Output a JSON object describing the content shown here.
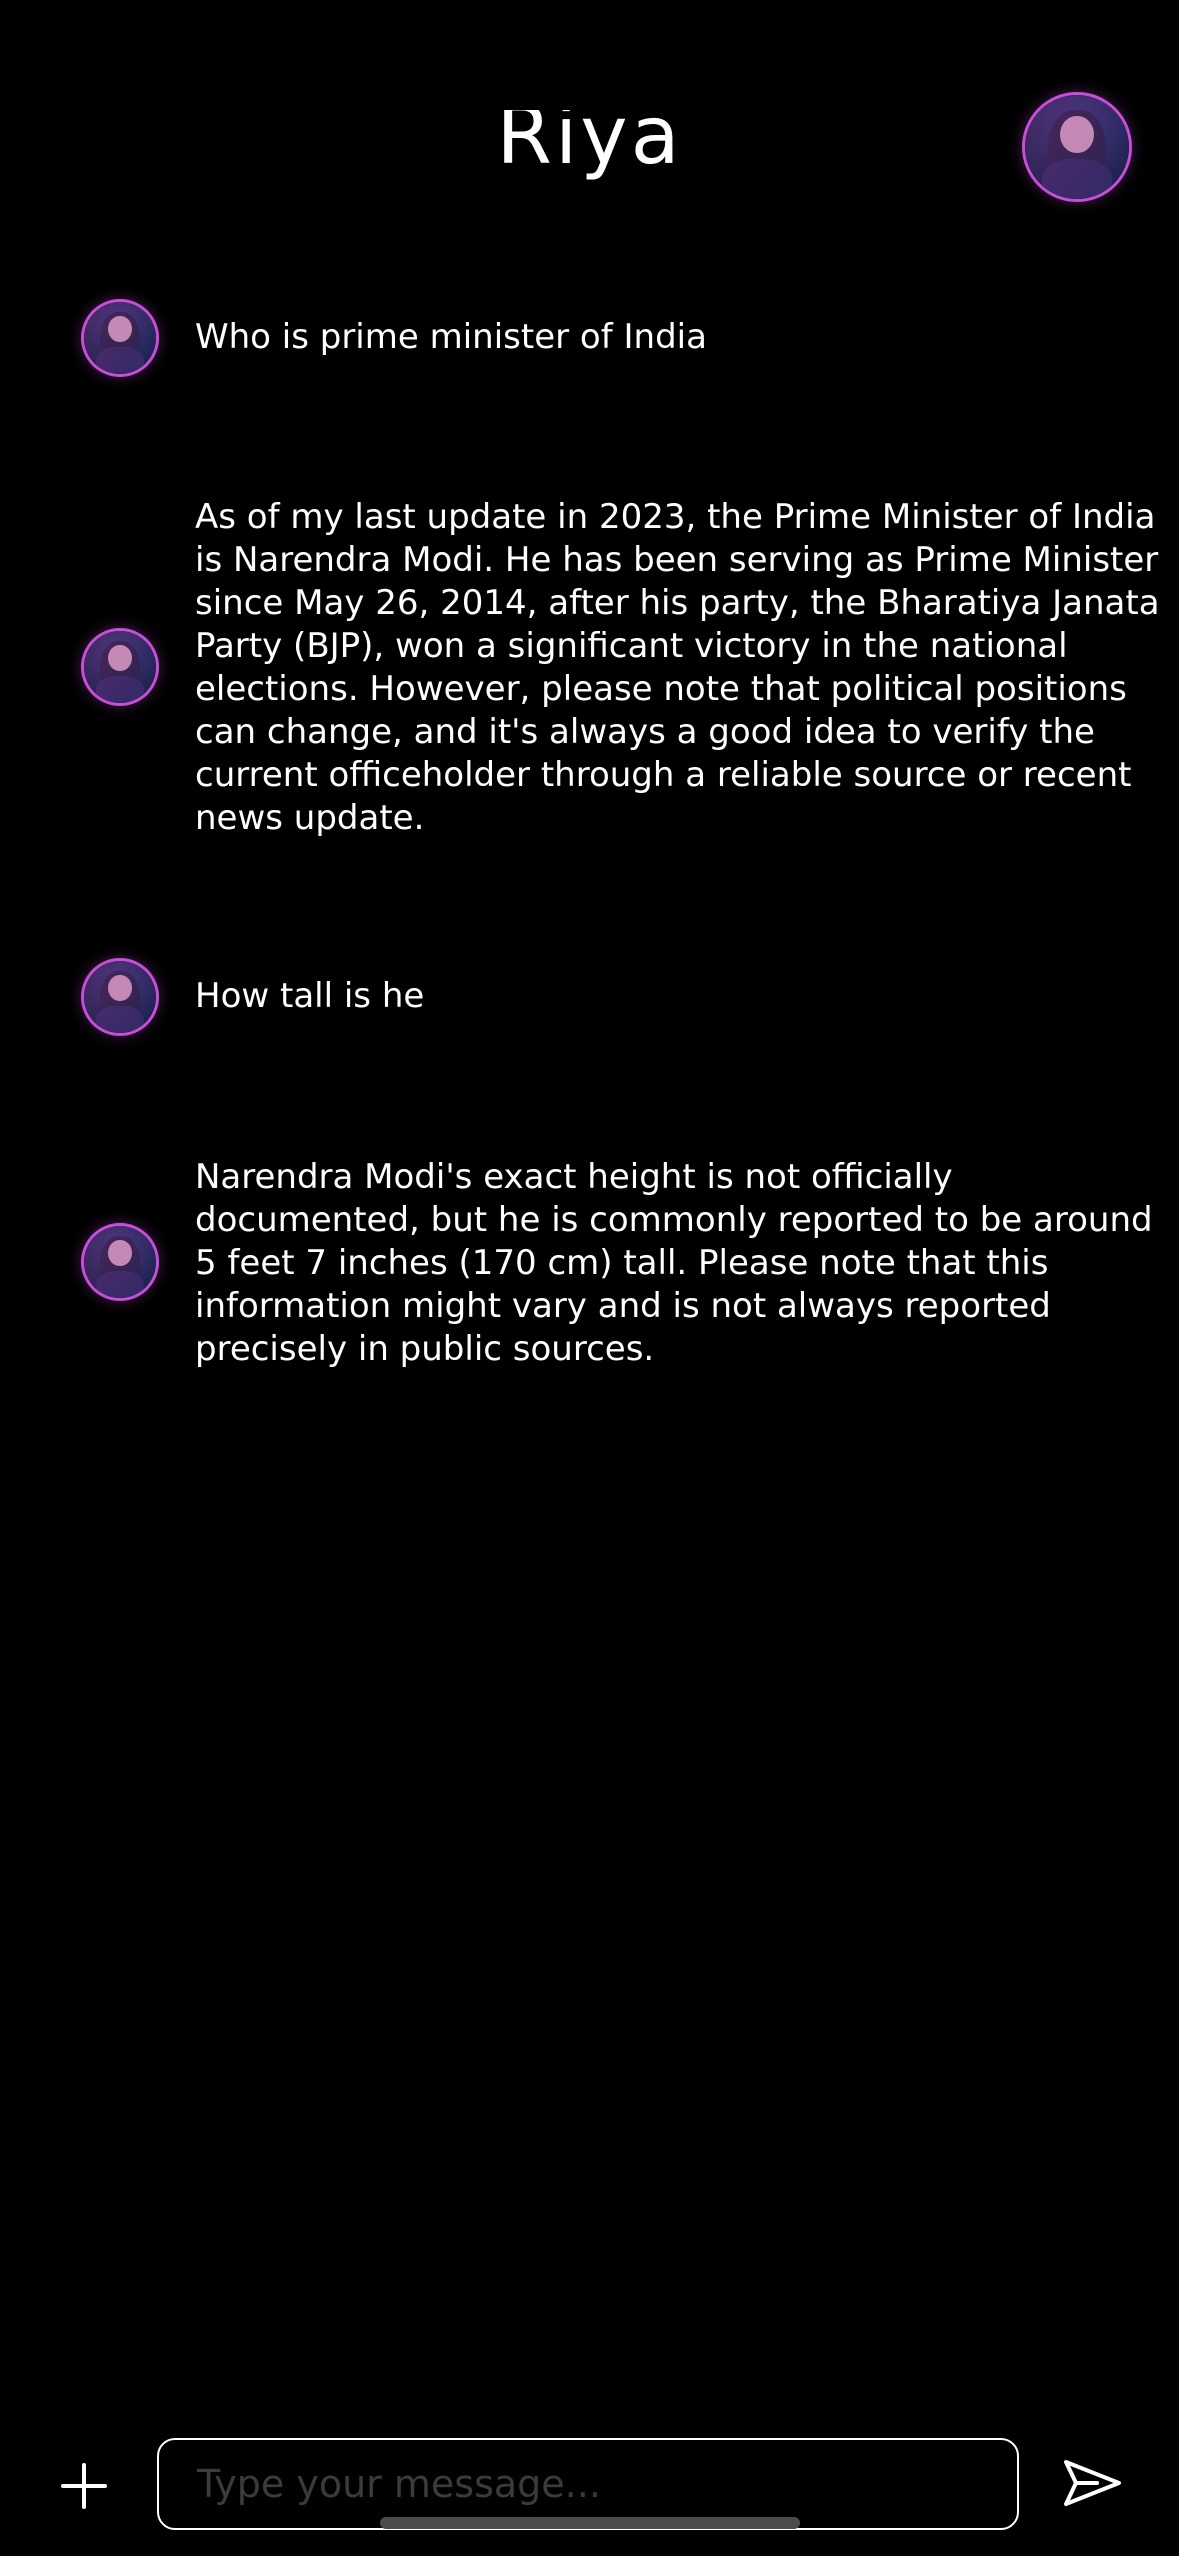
{
  "header": {
    "title": "Riya"
  },
  "messages": [
    {
      "role": "user",
      "text": "Who is prime minister of India"
    },
    {
      "role": "assistant",
      "text": "As of my last update in 2023, the Prime Minister of India is Narendra Modi. He has been serving as Prime Minister since May 26, 2014, after his party, the Bharatiya Janata Party (BJP), won a significant victory in the national elections. However, please note that political positions can change, and it's always a good idea to verify the current officeholder through a reliable source or recent news update."
    },
    {
      "role": "user",
      "text": "How tall is he"
    },
    {
      "role": "assistant",
      "text": "Narendra Modi's exact height is not officially documented, but he is commonly reported to be around 5 feet 7 inches (170 cm) tall. Please note that this information might vary and is not always reported precisely in public sources."
    }
  ],
  "composer": {
    "placeholder": "Type your message...",
    "value": ""
  },
  "icons": {
    "add": "plus-icon",
    "send": "send-arrow-icon"
  },
  "colors": {
    "background": "#000000",
    "text": "#ffffff",
    "avatar_ring": "#c54fd8",
    "placeholder": "#3b3b3b"
  }
}
